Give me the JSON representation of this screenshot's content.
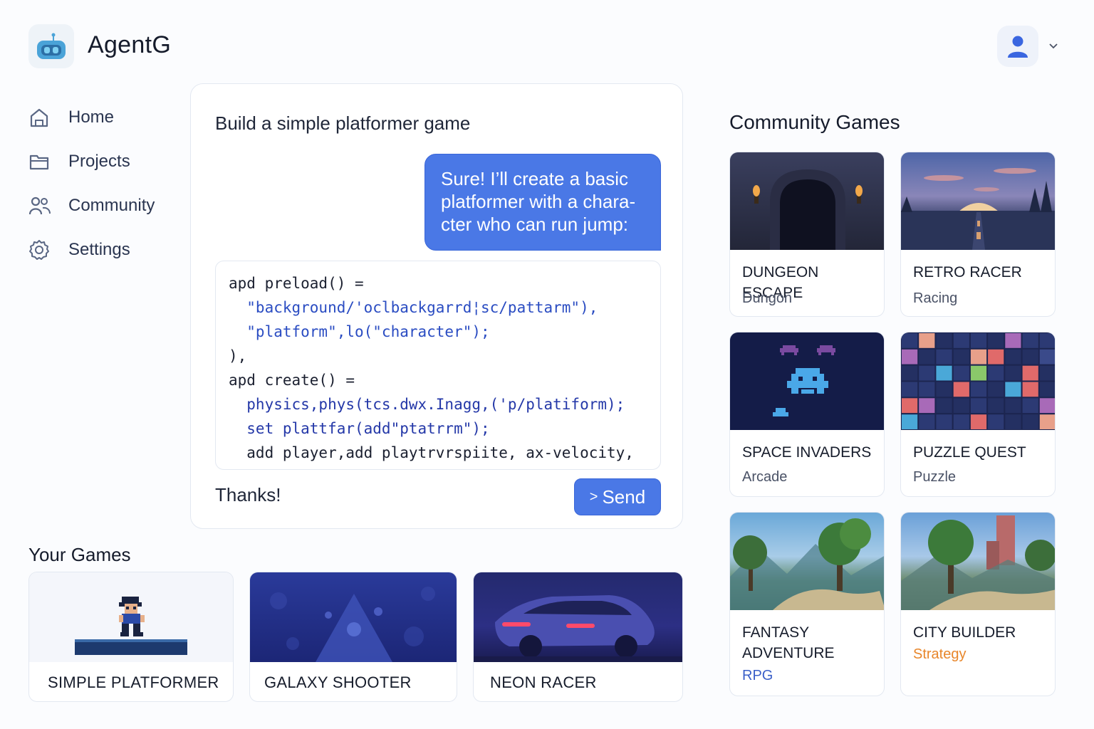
{
  "app": {
    "title": "AgentG"
  },
  "sidebar": {
    "items": [
      {
        "label": "Home",
        "icon": "home-icon"
      },
      {
        "label": "Projects",
        "icon": "folder-icon"
      },
      {
        "label": "Community",
        "icon": "users-icon"
      },
      {
        "label": "Settings",
        "icon": "gear-icon"
      }
    ]
  },
  "chat": {
    "prompt": "Build a simple platformer game",
    "reply_lines": [
      "Sure! I’ll create a basic",
      "platformer with a chara-",
      "cter who can run jump:"
    ],
    "code_lines": [
      "apd preload() =",
      "  \"background/'oclbackgarrd¦sc/pattarm\"),",
      "  \"platform\",lo(\"character\");",
      "),",
      "apd create() =",
      "  physics,phys(tcs.dwx.Inagg,('p/platiform);",
      "  set plattfar(add\"ptatrrm\");",
      "  add player,add playtrvrspiite, ax-velocity,"
    ],
    "last_message": "Thanks!",
    "send_label": "Send"
  },
  "your_games": {
    "title": "Your Games",
    "items": [
      {
        "name": "SIMPLE PLATFORMER"
      },
      {
        "name": "GALAXY SHOOTER"
      },
      {
        "name": "NEON RACER"
      }
    ]
  },
  "community": {
    "title": "Community Games",
    "items": [
      {
        "name": "DUNGEON ESCAPE",
        "genre": "Dungon"
      },
      {
        "name": "RETRO RACER",
        "genre": "Racing"
      },
      {
        "name": "SPACE INVADERS",
        "genre": "Arcade"
      },
      {
        "name": "PUZZLE QUEST",
        "genre": "Puzzle"
      },
      {
        "name": "FANTASY ADVENTURE",
        "genre": "RPG"
      },
      {
        "name": "CITY BUILDER",
        "genre": "Strategy"
      }
    ]
  },
  "colors": {
    "accent": "#4a78e6",
    "strategy_genre": "#e8862a",
    "rpg_genre": "#3a5fc8"
  }
}
